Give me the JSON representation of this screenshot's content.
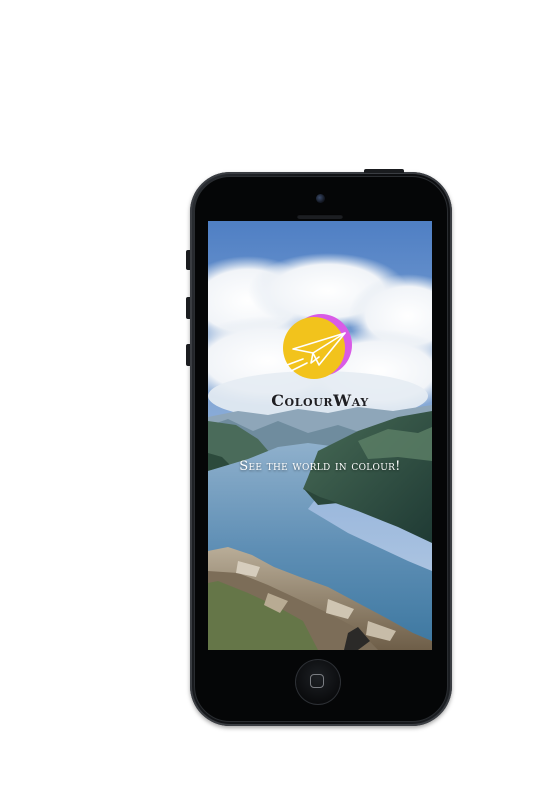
{
  "app": {
    "brand_name": "ColourWay",
    "tagline": "See the world in colour!"
  },
  "icons": {
    "logo": "paper-plane-sun-icon",
    "home": "home-square-icon"
  },
  "colors": {
    "logo_yellow": "#F2C31C",
    "logo_magenta": "#D95BE6",
    "sky_blue": "#5A86C6",
    "water_blue": "#5B86AE"
  }
}
